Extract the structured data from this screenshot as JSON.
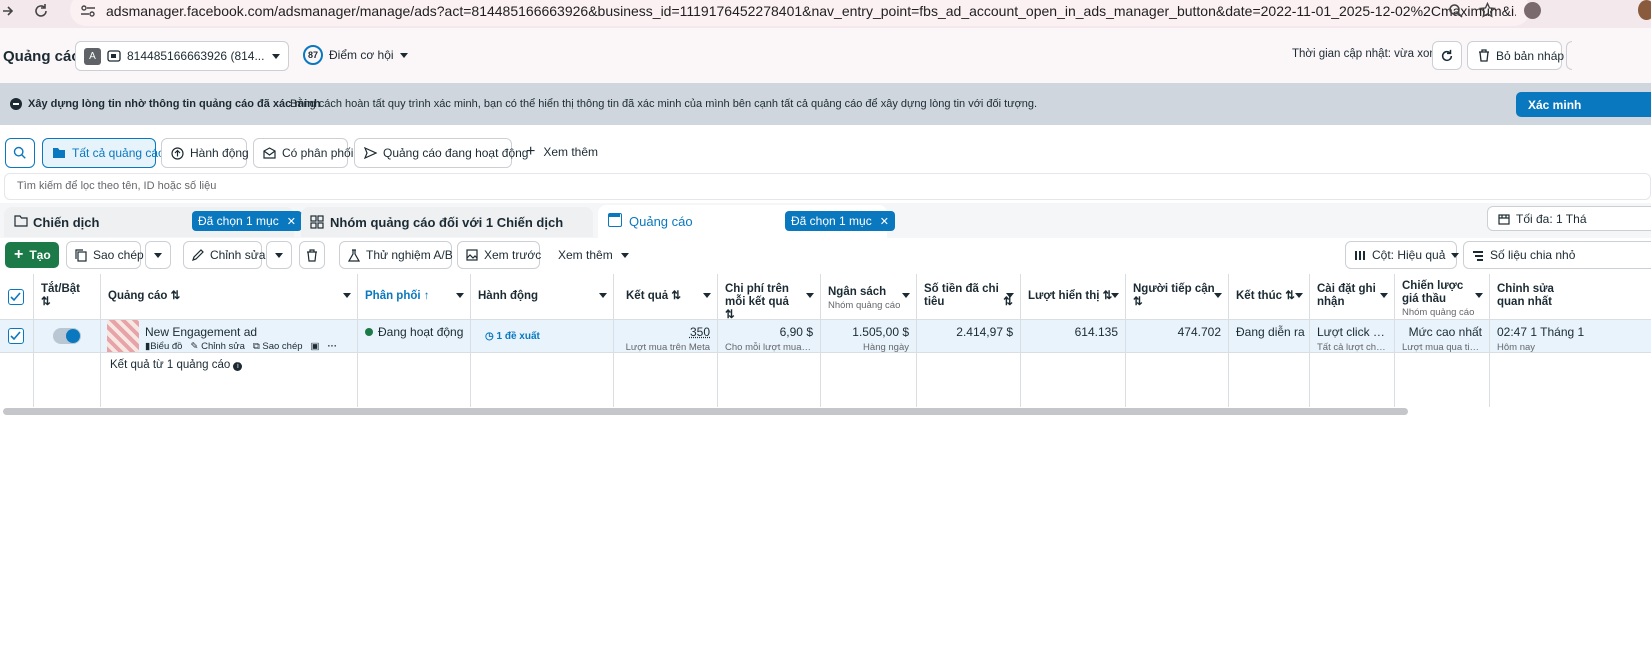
{
  "browser": {
    "url": "adsmanager.facebook.com/adsmanager/manage/ads?act=814485166663926&business_id=1119176452278401&nav_entry_point=fbs_ad_account_open_in_ads_manager_button&date=2022-11-01_2025-12-02%2Cmaximum&i..."
  },
  "header": {
    "title": "Quảng cáo",
    "account_badge": "A",
    "account_label": "814485166663926 (814...",
    "score": "87",
    "score_label": "Điểm cơ hội",
    "updated_text": "Thời gian cập nhật: vừa xong",
    "discard_label": "Bỏ bản nháp"
  },
  "banner": {
    "title": "Xây dựng lòng tin nhờ thông tin quảng cáo đã xác minh",
    "text": "Bằng cách hoàn tất quy trình xác minh, bạn có thể hiển thị thông tin đã xác minh của mình bên cạnh tất cả quảng cáo để xây dựng lòng tin với đối tượng.",
    "button": "Xác minh"
  },
  "filters": {
    "tabs": [
      "Tất cả quảng cáo",
      "Hành động",
      "Có phân phối",
      "Quảng cáo đang hoạt động"
    ],
    "more": "Xem thêm",
    "search_placeholder": "Tìm kiếm để lọc theo tên, ID hoặc số liệu"
  },
  "levels": {
    "campaign": "Chiến dịch",
    "campaign_selected": "Đã chọn 1 mục",
    "adset": "Nhóm quảng cáo đối với 1 Chiến dịch",
    "ads": "Quảng cáo",
    "ads_selected": "Đã chọn 1 mục",
    "max_label": "Tối đa: 1 Thá"
  },
  "toolbar": {
    "create": "Tạo",
    "duplicate": "Sao chép",
    "edit": "Chỉnh sửa",
    "ab_test": "Thử nghiệm A/B",
    "preview": "Xem trước",
    "more": "Xem thêm",
    "columns": "Cột: Hiệu quả",
    "breakdown": "Số liệu chia nhỏ"
  },
  "table": {
    "headers": {
      "toggle": "Tắt/Bật",
      "ad": "Quảng cáo",
      "delivery": "Phân phối",
      "actions": "Hành động",
      "results": "Kết quả",
      "cost_per_result": "Chi phí trên mỗi kết quả",
      "budget": "Ngân sách",
      "budget_sub": "Nhóm quảng cáo",
      "amount_spent": "Số tiền đã chi tiêu",
      "impressions": "Lượt hiển thị",
      "reach": "Người tiếp cận",
      "ends": "Kết thúc",
      "attribution": "Cài đặt ghi nhận",
      "bid_strategy": "Chiến lược giá thầu",
      "bid_strategy_sub": "Nhóm quảng cáo",
      "last_edited": "Chỉnh sửa quan nhất"
    },
    "row": {
      "ad_name": "New Engagement ad",
      "link_chart": "Biểu đồ",
      "link_edit": "Chỉnh sửa",
      "link_duplicate": "Sao chép",
      "delivery": "Đang hoạt động",
      "actions": "1 đề xuất",
      "results": "350",
      "results_sub": "Lượt mua trên Meta",
      "cost_per_result": "6,90 $",
      "cost_sub": "Cho mỗi lượt mua trê...",
      "budget": "1.505,00 $",
      "budget_sub": "Hàng ngày",
      "amount_spent": "2.414,97 $",
      "impressions": "614.135",
      "reach": "474.702",
      "ends": "Đang diễn ra",
      "attribution": "Lượt click tro...",
      "attribution_sub": "Tất cả lượt chuyể...",
      "bid_strategy": "Mức cao nhất",
      "bid_strategy_sub": "Lượt mua qua tin n...",
      "last_edited": "02:47 1 Tháng 1",
      "last_edited_sub": "Hôm nay"
    },
    "footer": "Kết quả từ 1 quảng cáo"
  },
  "colors": {
    "accent": "#0a78be",
    "create_button": "#1b7a47",
    "active_dot": "#1b7a47"
  }
}
